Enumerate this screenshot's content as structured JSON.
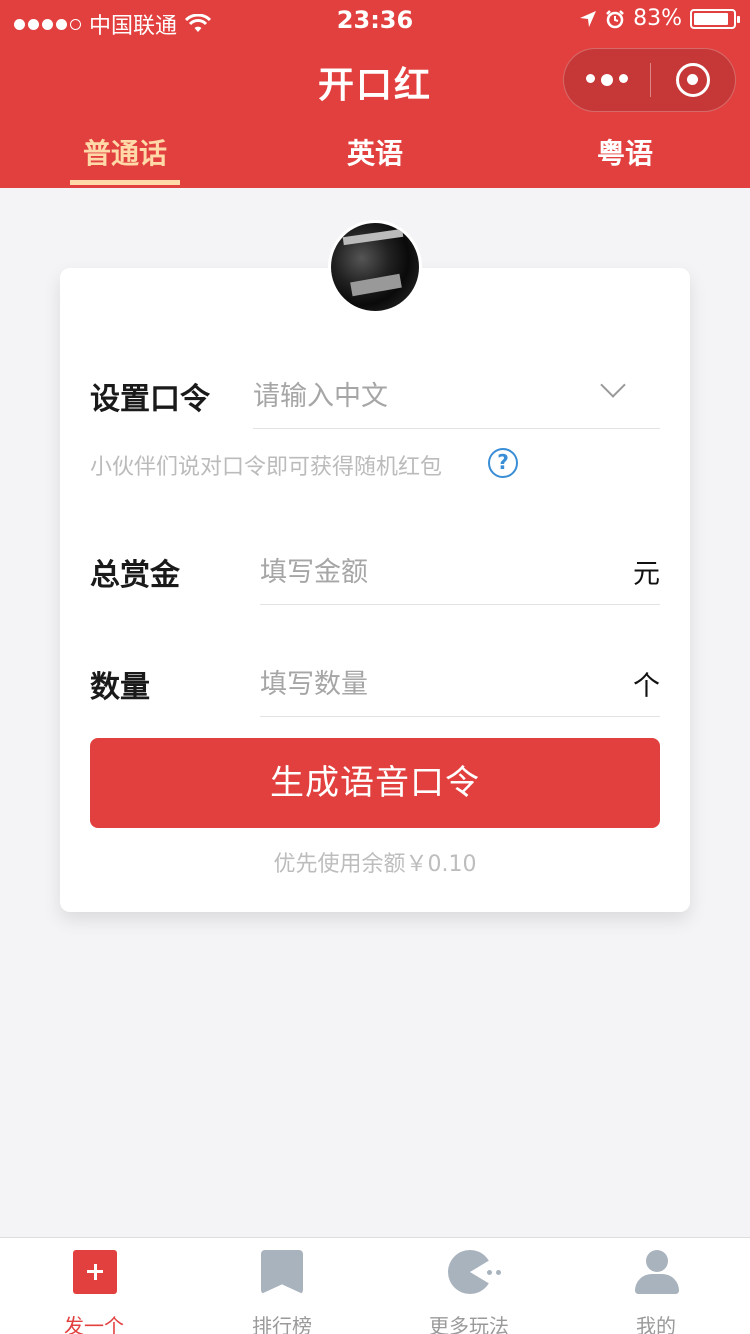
{
  "status_bar": {
    "carrier": "中国联通",
    "time": "23:36",
    "battery": "83%",
    "battery_level": 0.83
  },
  "nav": {
    "title": "开口红"
  },
  "tabs": [
    {
      "label": "普通话",
      "active": true
    },
    {
      "label": "英语",
      "active": false
    },
    {
      "label": "粤语",
      "active": false
    }
  ],
  "form": {
    "password": {
      "label": "设置口令",
      "placeholder": "请输入中文"
    },
    "hint": "小伙伴们说对口令即可获得随机红包",
    "amount": {
      "label": "总赏金",
      "placeholder": "填写金额",
      "unit": "元"
    },
    "quantity": {
      "label": "数量",
      "placeholder": "填写数量",
      "unit": "个"
    },
    "submit_label": "生成语音口令",
    "balance_text": "优先使用余额￥0.10"
  },
  "tabbar": [
    {
      "label": "发一个",
      "icon": "plus-icon",
      "active": true
    },
    {
      "label": "排行榜",
      "icon": "bookmark-icon",
      "active": false
    },
    {
      "label": "更多玩法",
      "icon": "pacman-icon",
      "active": false
    },
    {
      "label": "我的",
      "icon": "user-icon",
      "active": false
    }
  ],
  "colors": {
    "primary": "#e2403f",
    "tab_active": "#ffd9a8",
    "help_blue": "#3a8ed6"
  }
}
